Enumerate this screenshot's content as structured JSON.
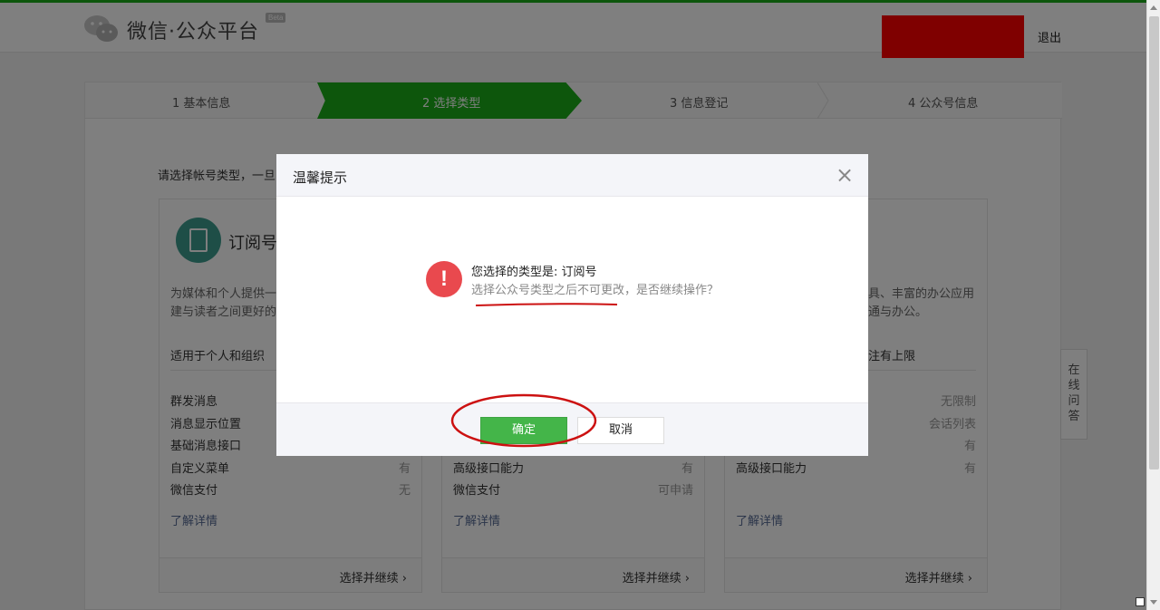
{
  "header": {
    "logo_text": "微信·公众平台",
    "beta": "Beta",
    "logout": "退出",
    "user_block_color": "#ff0000"
  },
  "steps": [
    {
      "label": "1 基本信息"
    },
    {
      "label": "2 选择类型",
      "active": true
    },
    {
      "label": "3 信息登记"
    },
    {
      "label": "4 公众号信息"
    }
  ],
  "intro": "请选择帐号类型，一旦",
  "cards": [
    {
      "title": "订阅号",
      "desc": "为媒体和个人提供一",
      "desc2": "建与读者之间更好的",
      "suitable": "适用于个人和组织",
      "features": [
        {
          "label": "群发消息",
          "value": ""
        },
        {
          "label": "消息显示位置",
          "value": ""
        },
        {
          "label": "基础消息接口",
          "value": ""
        },
        {
          "label": "自定义菜单",
          "value": "有"
        },
        {
          "label": "微信支付",
          "value": "无"
        }
      ],
      "link": "了解详情",
      "cta": "选择并继续"
    },
    {
      "title": "",
      "features": [
        {
          "label": "高级接口能力",
          "value": "有"
        },
        {
          "label": "微信支付",
          "value": "可申请"
        }
      ],
      "link": "了解详情",
      "cta": "选择并继续"
    },
    {
      "title": "",
      "desc": "具、丰富的办公应用",
      "desc2": "通与办公。",
      "suitable": "注有上限",
      "features": [
        {
          "label": "",
          "value": "无限制"
        },
        {
          "label": "",
          "value": "会话列表"
        },
        {
          "label": "",
          "value": "有"
        },
        {
          "label": "高级接口能力",
          "value": "有"
        }
      ],
      "link": "了解详情",
      "cta": "选择并继续"
    }
  ],
  "side_qa": "在线问答",
  "dialog": {
    "title": "温馨提示",
    "close_icon": "×",
    "message": "您选择的类型是: 订阅号",
    "sub_message": "选择公众号类型之后不可更改，是否继续操作？",
    "ok_label": "确定",
    "cancel_label": "取消",
    "warning_icon": "!"
  },
  "colors": {
    "brand_green": "#1aad19",
    "ok_button": "#44b549",
    "warning": "#e9494e",
    "annotation_red": "#cc1111"
  }
}
